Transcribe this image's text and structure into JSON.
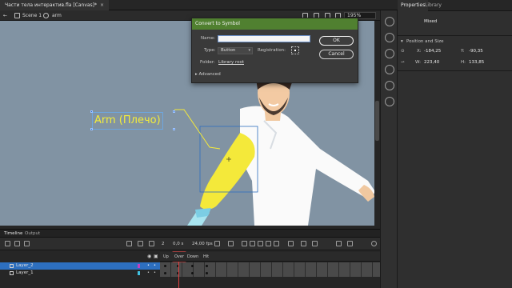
{
  "document": {
    "tab_title": "Части тела интерактив.fla [Canvas]*",
    "close_glyph": "×"
  },
  "scene": {
    "back_glyph": "←",
    "scene_label": "Scene 1",
    "symbol_label": "arm",
    "zoom": "195%"
  },
  "stage": {
    "arm_label": "Arm (Плечо)",
    "background_color": "#8193a3",
    "arm_color": "#f4e93a"
  },
  "dialog": {
    "title": "Convert to Symbol",
    "name_label": "Name:",
    "name_value": "",
    "type_label": "Type:",
    "type_value": "Button",
    "registration_label": "Registration:",
    "folder_label": "Folder:",
    "folder_value": "Library root",
    "advanced_label": "Advanced",
    "ok_label": "OK",
    "cancel_label": "Cancel"
  },
  "properties": {
    "tabs": [
      "Properties",
      "Library"
    ],
    "mixed_label": "Mixed",
    "position_section": "Position and Size",
    "x_label": "X:",
    "x_value": "-184,25",
    "y_label": "Y:",
    "y_value": "-90,35",
    "w_label": "W:",
    "w_value": "223,40",
    "h_label": "H:",
    "h_value": "133,85"
  },
  "timeline": {
    "tabs": [
      "Timeline",
      "Output"
    ],
    "current_frame": "2",
    "time": "0,0 s",
    "fps": "24,00 fps",
    "frame_labels": [
      "Up",
      "Over",
      "Down",
      "Hit"
    ],
    "layers": [
      {
        "name": "Layer_2",
        "selected": true,
        "color": "#c040c0"
      },
      {
        "name": "Layer_1",
        "selected": false,
        "color": "#40c0e0"
      }
    ]
  },
  "colors": {
    "accent_green": "#508030",
    "selection_blue": "#2d6fbf",
    "playhead_red": "#9d3d3d"
  }
}
